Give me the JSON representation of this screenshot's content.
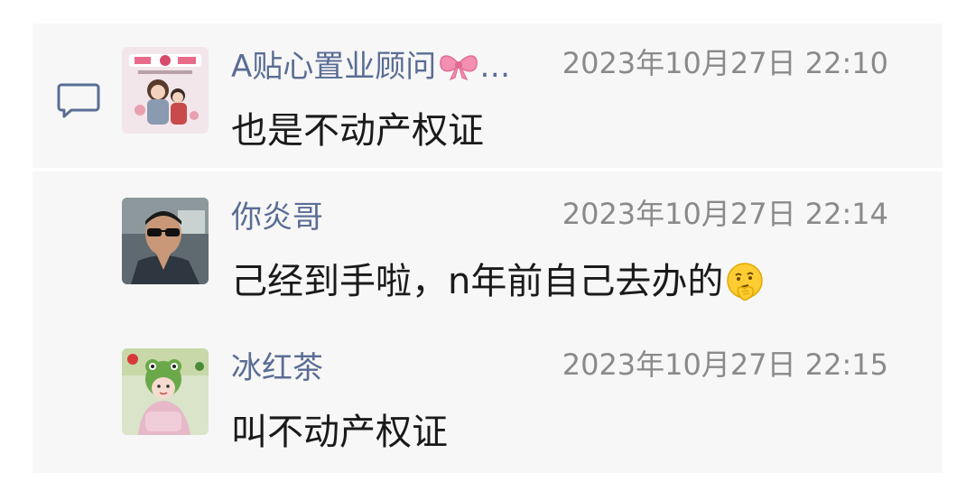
{
  "messages": [
    {
      "sender": "A贴心置业顾问",
      "sender_suffix": "…",
      "time": "2023年10月27日 22:10",
      "text": "也是不动产权证"
    },
    {
      "sender": "你炎哥",
      "time": "2023年10月27日 22:14",
      "text": "己经到手啦，n年前自己去办的"
    },
    {
      "sender": "冰红茶",
      "time": "2023年10月27日 22:15",
      "text": "叫不动产权证"
    }
  ],
  "icons": {
    "comment": "comment-icon",
    "bow": "bow-emoji-icon",
    "thinking": "thinking-face-emoji-icon"
  },
  "colors": {
    "name": "#5a6d94",
    "time": "#8a8a8a",
    "text": "#1a1a1a",
    "panel": "#f7f7f7"
  }
}
